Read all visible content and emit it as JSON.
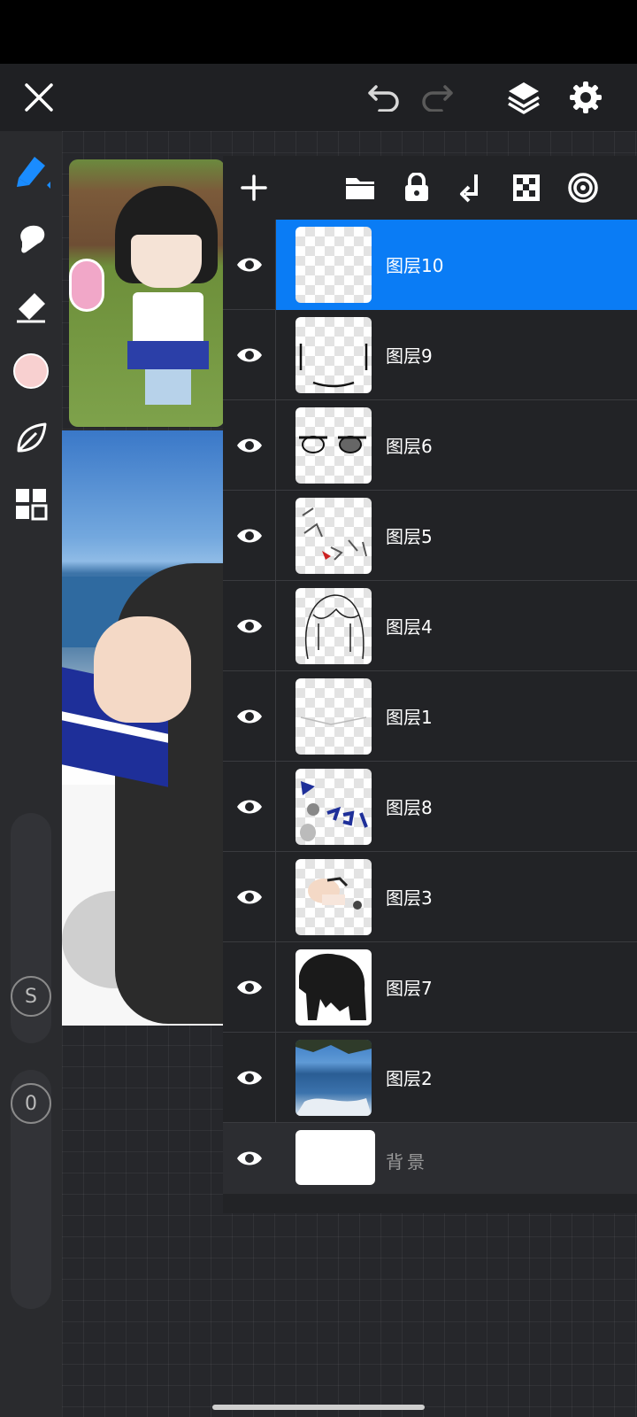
{
  "colors": {
    "accent": "#0a7cf5",
    "panel": "#222326",
    "toolbar": "#1f2023",
    "current_color": "#f8d0d0"
  },
  "top_toolbar": {
    "icons": [
      "close-icon",
      "undo-icon",
      "redo-icon",
      "layers-icon",
      "settings-icon"
    ]
  },
  "left_toolbar": {
    "tools": [
      "brush-icon",
      "smudge-icon",
      "eraser-icon",
      "color-swatch",
      "leaf-icon",
      "grid-icon"
    ],
    "size_label": "S",
    "opacity_label": "0"
  },
  "layers_panel": {
    "header_icons": [
      "add-icon",
      "folder-icon",
      "lock-icon",
      "merge-down-icon",
      "checkerboard-icon",
      "blend-icon"
    ],
    "layers": [
      {
        "name": "图层10",
        "selected": true
      },
      {
        "name": "图层9",
        "selected": false
      },
      {
        "name": "图层6",
        "selected": false
      },
      {
        "name": "图层5",
        "selected": false
      },
      {
        "name": "图层4",
        "selected": false
      },
      {
        "name": "图层1",
        "selected": false
      },
      {
        "name": "图层8",
        "selected": false
      },
      {
        "name": "图层3",
        "selected": false
      },
      {
        "name": "图层7",
        "selected": false
      },
      {
        "name": "图层2",
        "selected": false
      }
    ],
    "background_label": "背景"
  }
}
